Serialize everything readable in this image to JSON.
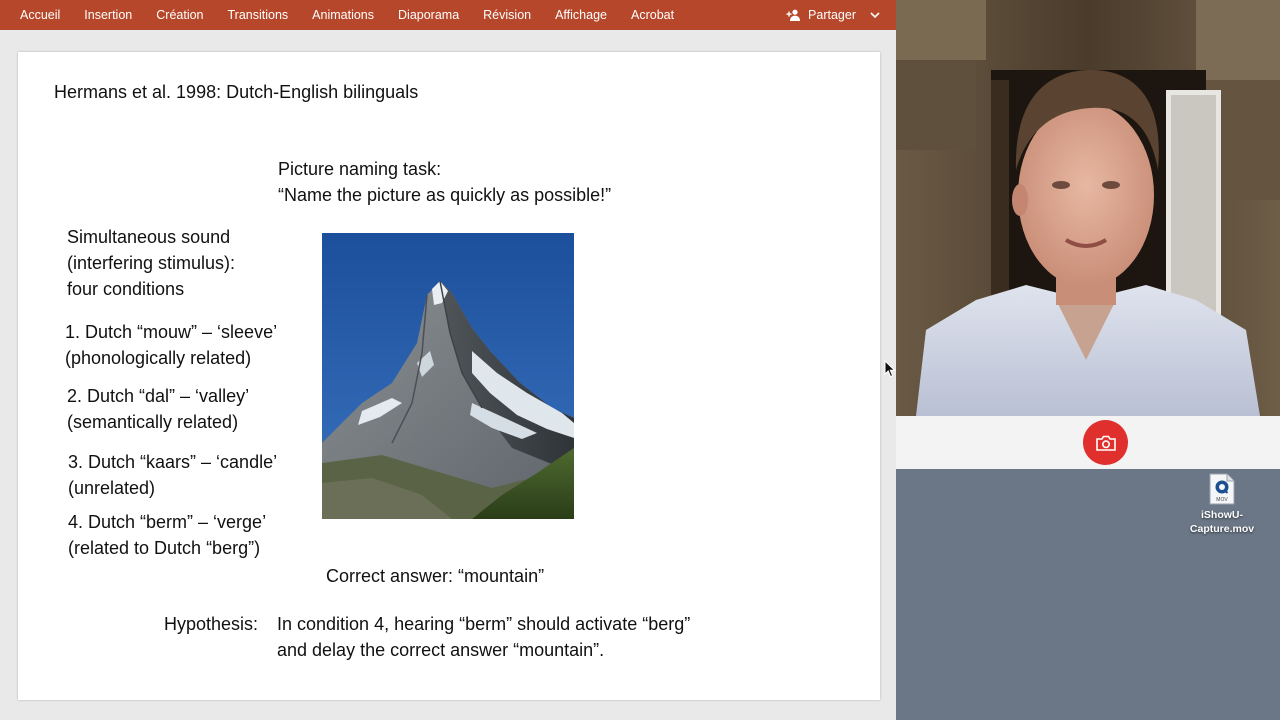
{
  "ribbon": {
    "tabs": [
      "Accueil",
      "Insertion",
      "Création",
      "Transitions",
      "Animations",
      "Diaporama",
      "Révision",
      "Affichage",
      "Acrobat"
    ],
    "share_label": "Partager"
  },
  "slide": {
    "title": "Hermans et al. 1998: Dutch-English bilinguals",
    "task_title": "Picture naming task:",
    "task_instruction": "“Name the picture as quickly as possible!”",
    "simultaneous_lines": [
      "Simultaneous sound",
      "(interfering stimulus):",
      "four conditions"
    ],
    "conditions": [
      {
        "line1": "1. Dutch “mouw” – ‘sleeve’",
        "line2": "(phonologically related)"
      },
      {
        "line1": "2. Dutch “dal” – ‘valley’",
        "line2": "(semantically related)"
      },
      {
        "line1": "3. Dutch “kaars” – ‘candle’",
        "line2": "(unrelated)"
      },
      {
        "line1": "4. Dutch “berm” – ‘verge’",
        "line2": "(related to Dutch “berg”)"
      }
    ],
    "correct_answer": "Correct answer: “mountain”",
    "hypothesis_label": "Hypothesis:",
    "hypothesis_lines": [
      "In condition 4, hearing “berm” should activate “berg”",
      "and delay the correct answer “mountain”."
    ]
  },
  "desktop": {
    "file_name": "iShowU-\nCapture.mov",
    "file_badge": "MOV"
  },
  "colors": {
    "ribbon": "#b7472a",
    "record_button": "#e0302d",
    "desktop": "#6b7787"
  },
  "icons": {
    "share": "person-add-icon",
    "share_menu": "chevron-down-icon",
    "record": "camera-icon",
    "file": "quicktime-file-icon",
    "cursor": "mouse-pointer-icon"
  }
}
